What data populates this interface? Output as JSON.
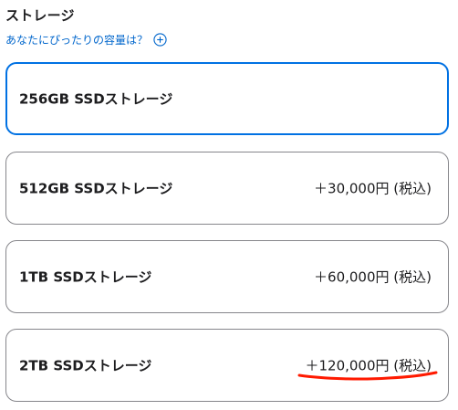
{
  "section": {
    "title": "ストレージ",
    "help_link": "あなたにぴったりの容量は？",
    "help_icon": "plus-circle-icon"
  },
  "options": [
    {
      "label": "256GB SSDストレージ",
      "price": "",
      "selected": true
    },
    {
      "label": "512GB SSDストレージ",
      "price": "＋30,000円 (税込)",
      "selected": false
    },
    {
      "label": "1TB SSDストレージ",
      "price": "＋60,000円 (税込)",
      "selected": false
    },
    {
      "label": "2TB SSDストレージ",
      "price": "＋120,000円 (税込)",
      "selected": false
    }
  ],
  "annotation": {
    "underline_color": "#ff1a00",
    "target": "2TB SSDストレージ price"
  },
  "colors": {
    "accent": "#0071e3",
    "link": "#0066cc",
    "border": "#86868b"
  }
}
